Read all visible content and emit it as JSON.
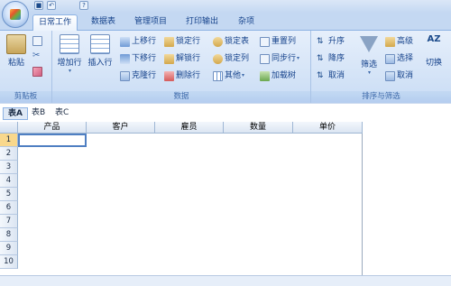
{
  "quick_access": {
    "icons": [
      "save-icon",
      "undo-icon",
      "redo-icon",
      "help-icon"
    ]
  },
  "tabs": [
    {
      "label": "日常工作",
      "active": true
    },
    {
      "label": "数据表",
      "active": false
    },
    {
      "label": "管理项目",
      "active": false
    },
    {
      "label": "打印输出",
      "active": false
    },
    {
      "label": "杂项",
      "active": false
    }
  ],
  "ribbon": {
    "clipboard": {
      "label": "剪贴板",
      "paste": "粘贴"
    },
    "data": {
      "label": "数据",
      "add_row": "增加行",
      "insert_row": "插入行",
      "move_up": "上移行",
      "move_down": "下移行",
      "clone_row": "克隆行",
      "lock_row": "锁定行",
      "unlock_row": "解锁行",
      "delete_row": "删除行",
      "lock_table": "锁定表",
      "lock_column": "锁定列",
      "other": "其他",
      "reset_column": "重置列",
      "sync_row": "同步行",
      "load_tree": "加载树"
    },
    "sort_filter": {
      "label": "排序与筛选",
      "asc": "升序",
      "desc": "降序",
      "cancel_sort": "取消",
      "filter": "筛选",
      "advanced": "高级",
      "select": "选择",
      "cancel_filter": "取消",
      "toggle": "切换"
    }
  },
  "sheet_tabs": [
    {
      "label": "表A",
      "active": true
    },
    {
      "label": "表B",
      "active": false
    },
    {
      "label": "表C",
      "active": false
    }
  ],
  "grid": {
    "columns": [
      "产品",
      "客户",
      "雇员",
      "数量",
      "单价"
    ],
    "rows": [
      "1",
      "2",
      "3",
      "4",
      "5",
      "6",
      "7",
      "8",
      "9",
      "10"
    ],
    "selected_cell": "A1"
  },
  "colors": {
    "accent": "#15428b",
    "ribbon_bg": "#d5e4f7",
    "selection": "#4f7fc2"
  }
}
